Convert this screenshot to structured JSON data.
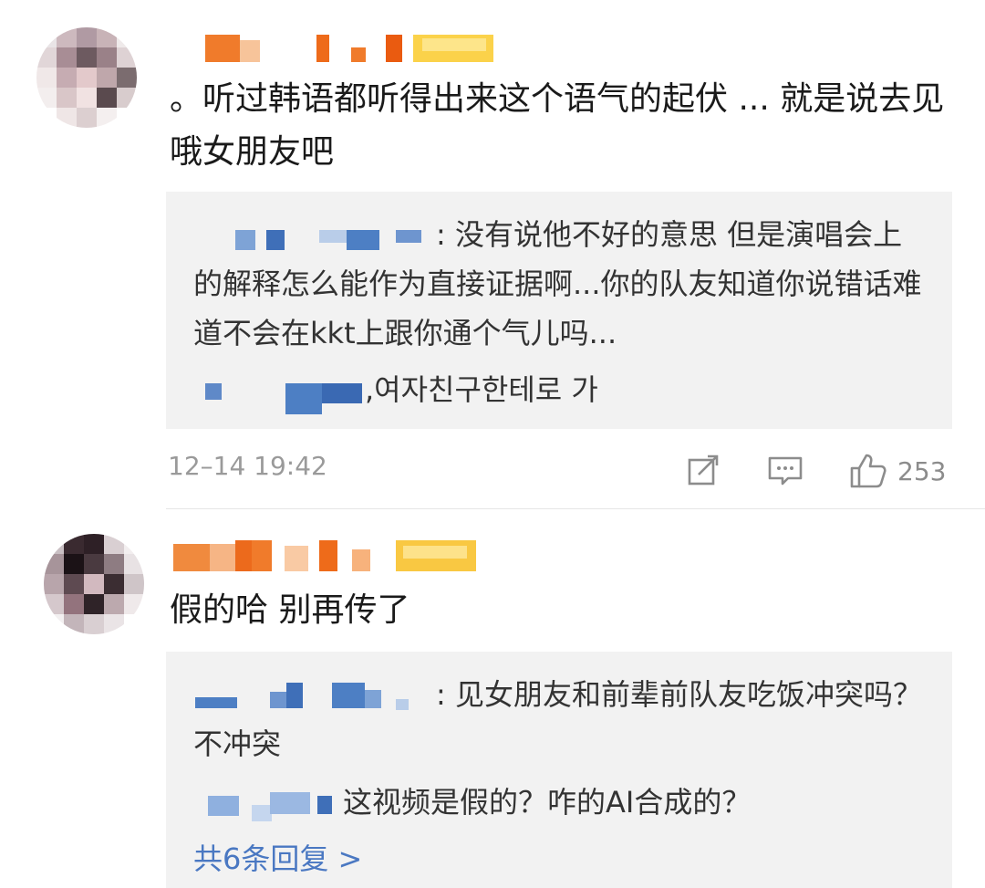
{
  "comments": [
    {
      "text": "。听过韩语都听得出来这个语气的起伏 ... 就是说去见哦女朋友吧",
      "replies": [
        {
          "text": ": 没有说他不好的意思 但是演唱会上的解释怎么能作为直接证据啊...你的队友知道你说错话难道不会在kkt上跟你通个气儿吗..."
        },
        {
          "text": ",여자친구한테로 가"
        }
      ],
      "timestamp": "12–14 19:42",
      "like_count": "253"
    },
    {
      "text": "假的哈 别再传了",
      "replies": [
        {
          "text": ": 见女朋友和前辈前队友吃饭冲突吗？不冲突"
        },
        {
          "text": "这视频是假的？咋的AI合成的？"
        }
      ],
      "more_replies": "共6条回复 >"
    }
  ],
  "colors": {
    "link": "#4a78c2",
    "meta": "#9a9a9a",
    "reply_bg": "#f2f2f2"
  }
}
